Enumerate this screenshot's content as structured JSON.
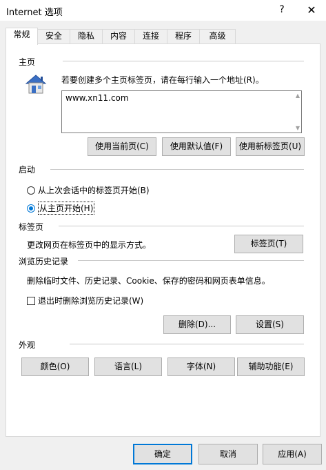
{
  "window": {
    "title": "Internet 选项",
    "help": "?",
    "close": "✕"
  },
  "tabs": [
    {
      "label": "常规",
      "active": true
    },
    {
      "label": "安全"
    },
    {
      "label": "隐私"
    },
    {
      "label": "内容"
    },
    {
      "label": "连接"
    },
    {
      "label": "程序"
    },
    {
      "label": "高级"
    }
  ],
  "homepage": {
    "section": "主页",
    "instruction": "若要创建多个主页标签页，请在每行输入一个地址(R)。",
    "urls": "www.xn11.com",
    "buttons": {
      "use_current": "使用当前页(C)",
      "use_default": "使用默认值(F)",
      "use_new_tab": "使用新标签页(U)"
    }
  },
  "startup": {
    "section": "启动",
    "option_last_session": "从上次会话中的标签页开始(B)",
    "option_homepage": "从主页开始(H)",
    "selected": "homepage"
  },
  "tabs_section": {
    "section": "标签页",
    "description": "更改网页在标签页中的显示方式。",
    "button": "标签页(T)"
  },
  "history": {
    "section": "浏览历史记录",
    "description": "删除临时文件、历史记录、Cookie、保存的密码和网页表单信息。",
    "checkbox": "退出时删除浏览历史记录(W)",
    "checked": false,
    "delete_button": "删除(D)...",
    "settings_button": "设置(S)"
  },
  "appearance": {
    "section": "外观",
    "colors": "颜色(O)",
    "languages": "语言(L)",
    "fonts": "字体(N)",
    "accessibility": "辅助功能(E)"
  },
  "footer": {
    "ok": "确定",
    "cancel": "取消",
    "apply": "应用(A)"
  }
}
